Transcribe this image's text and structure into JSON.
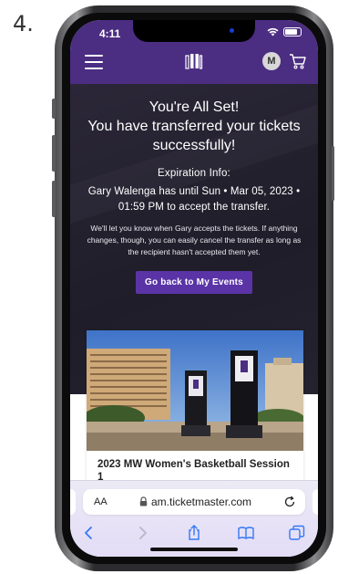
{
  "step_number": "4.",
  "status_bar": {
    "time": "4:11"
  },
  "nav": {
    "avatar_initial": "M"
  },
  "hero": {
    "title": "You're All Set!",
    "subtitle": "You have transferred your tickets successfully!",
    "expiration_label": "Expiration Info:",
    "expiration_text": "Gary Walenga has until Sun • Mar 05, 2023 • 01:59 PM to accept the transfer.",
    "info_text": "We'll let you know when Gary accepts the tickets. If anything changes, though, you can easily cancel the transfer as long as the recipient hasn't accepted them yet.",
    "button_label": "Go back to My Events"
  },
  "event_card": {
    "title": "2023 MW Women's Basketball Session 1"
  },
  "safari": {
    "text_size_label": "AA",
    "url": "am.ticketmaster.com"
  },
  "colors": {
    "nav_purple": "#4b2d82",
    "button_purple": "#5a34a6",
    "hero_dark": "#24222e",
    "ios_blue": "#3478f6"
  },
  "icons": [
    "menu-icon",
    "ticketmaster-logo-icon",
    "cart-icon",
    "wifi-icon",
    "battery-icon",
    "lock-icon",
    "reload-icon",
    "back-icon",
    "forward-icon",
    "share-icon",
    "bookmarks-icon",
    "tabs-icon"
  ]
}
